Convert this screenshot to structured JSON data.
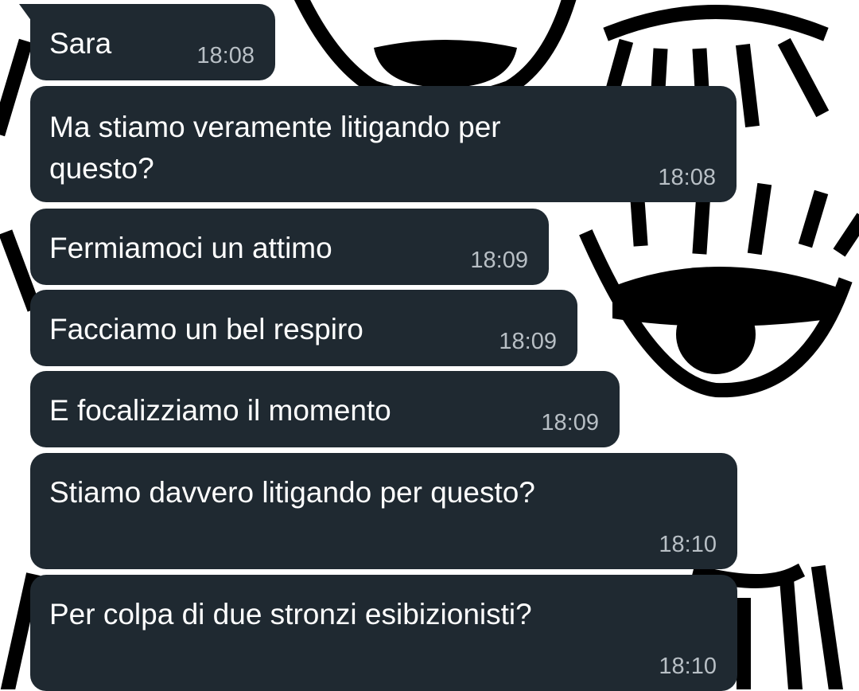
{
  "chat": {
    "sender": "Sara",
    "messages": [
      {
        "text": "Sara",
        "time": "18:08"
      },
      {
        "text": "Ma stiamo veramente litigando per\nquesto?",
        "time": "18:08"
      },
      {
        "text": "Fermiamoci un attimo",
        "time": "18:09"
      },
      {
        "text": "Facciamo un bel respiro",
        "time": "18:09"
      },
      {
        "text": "E focalizziamo il momento",
        "time": "18:09"
      },
      {
        "text": "Stiamo davvero litigando per questo?",
        "time": "18:10"
      },
      {
        "text": "Per colpa di due stronzi esibizionisti?",
        "time": "18:10"
      }
    ]
  },
  "colors": {
    "bubble": "#1f2931",
    "text": "#ffffff",
    "timestamp": "#b8bfc5",
    "wallpaper_bg": "#ffffff",
    "wallpaper_ink": "#000000"
  },
  "wallpaper": {
    "icon": "eye-pattern-icon"
  }
}
